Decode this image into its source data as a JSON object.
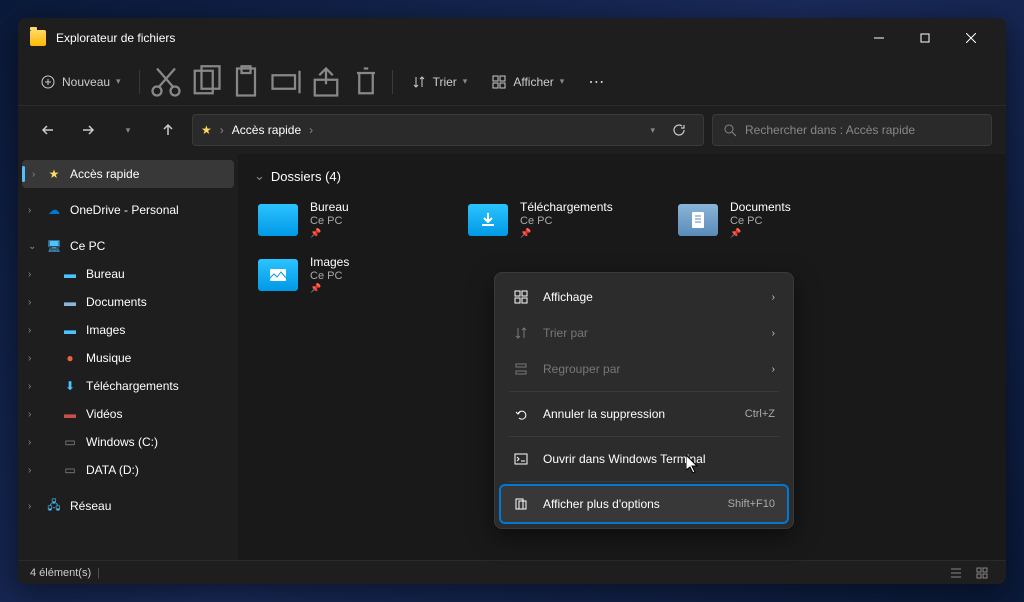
{
  "title": "Explorateur de fichiers",
  "toolbar": {
    "new": "Nouveau",
    "sort": "Trier",
    "view": "Afficher"
  },
  "breadcrumb": {
    "location": "Accès rapide"
  },
  "search": {
    "placeholder": "Rechercher dans : Accès rapide"
  },
  "sidebar": {
    "quick_access": "Accès rapide",
    "onedrive": "OneDrive - Personal",
    "this_pc": "Ce PC",
    "desktop": "Bureau",
    "documents": "Documents",
    "images": "Images",
    "music": "Musique",
    "downloads": "Téléchargements",
    "videos": "Vidéos",
    "windows_c": "Windows (C:)",
    "data_d": "DATA (D:)",
    "network": "Réseau"
  },
  "content": {
    "section_title": "Dossiers (4)",
    "folders": {
      "desktop": {
        "name": "Bureau",
        "location": "Ce PC"
      },
      "downloads": {
        "name": "Téléchargements",
        "location": "Ce PC"
      },
      "documents": {
        "name": "Documents",
        "location": "Ce PC"
      },
      "images": {
        "name": "Images",
        "location": "Ce PC"
      }
    }
  },
  "context_menu": {
    "view": "Affichage",
    "sort_by": "Trier par",
    "group_by": "Regrouper par",
    "undo": "Annuler la suppression",
    "undo_shortcut": "Ctrl+Z",
    "terminal": "Ouvrir dans Windows Terminal",
    "more_options": "Afficher plus d'options",
    "more_shortcut": "Shift+F10"
  },
  "statusbar": {
    "count": "4 élément(s)"
  }
}
